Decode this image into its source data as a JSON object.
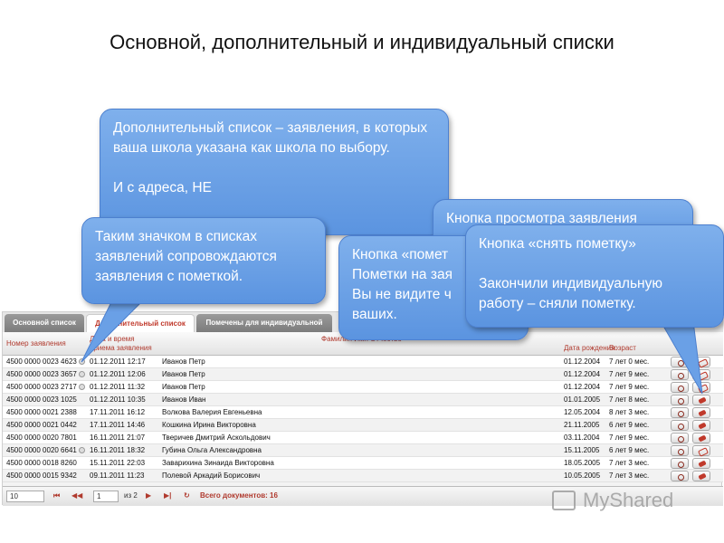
{
  "title": "Основной, дополнительный и индивидуальный списки",
  "tabs": [
    {
      "label": "Основной список",
      "active": false
    },
    {
      "label": "Дополнительный список",
      "active": true
    },
    {
      "label": "Помечены для индивидуальной работы",
      "active": false
    }
  ],
  "headers": {
    "number": "Номер заявления",
    "datetime_line1": "Дата и время",
    "datetime_line2": "приема заявления",
    "fio": "Фамилия Имя Отчество",
    "birth": "Дата рождения",
    "age": "Возраст"
  },
  "rows": [
    {
      "number": "4500 0000 0023 4623",
      "marked": true,
      "datetime": "01.12.2011 12:17",
      "name": "Иванов Петр",
      "birth": "01.12.2004",
      "age": "7 лет 0 мес."
    },
    {
      "number": "4500 0000 0023 3657",
      "marked": true,
      "datetime": "01.12.2011 12:06",
      "name": "Иванов Петр",
      "birth": "01.12.2004",
      "age": "7 лет 9 мес."
    },
    {
      "number": "4500 0000 0023 2717",
      "marked": true,
      "datetime": "01.12.2011 11:32",
      "name": "Иванов Петр",
      "birth": "01.12.2004",
      "age": "7 лет 9 мес."
    },
    {
      "number": "4500 0000 0023 1025",
      "marked": false,
      "datetime": "01.12.2011 10:35",
      "name": "Иванов Иван",
      "birth": "01.01.2005",
      "age": "7 лет 8 мес."
    },
    {
      "number": "4500 0000 0021 2388",
      "marked": false,
      "datetime": "17.11.2011 16:12",
      "name": "Волкова Валерия Евгеньевна",
      "birth": "12.05.2004",
      "age": "8 лет 3 мес."
    },
    {
      "number": "4500 0000 0021 0442",
      "marked": false,
      "datetime": "17.11.2011 14:46",
      "name": "Кошкина Ирина Викторовна",
      "birth": "21.11.2005",
      "age": "6 лет 9 мес."
    },
    {
      "number": "4500 0000 0020 7801",
      "marked": false,
      "datetime": "16.11.2011 21:07",
      "name": "Тверичев Дмитрий Аскольдович",
      "birth": "03.11.2004",
      "age": "7 лет 9 мес."
    },
    {
      "number": "4500 0000 0020 6641",
      "marked": true,
      "datetime": "16.11.2011 18:32",
      "name": "Губина Ольга Александровна",
      "birth": "15.11.2005",
      "age": "6 лет 9 мес."
    },
    {
      "number": "4500 0000 0018 8260",
      "marked": false,
      "datetime": "15.11.2011 22:03",
      "name": "Заварихина Зинаида Викторовна",
      "birth": "18.05.2005",
      "age": "7 лет 3 мес."
    },
    {
      "number": "4500 0000 0015 9342",
      "marked": false,
      "datetime": "09.11.2011 11:23",
      "name": "Полевой Аркадий Борисович",
      "birth": "10.05.2005",
      "age": "7 лет 3 мес."
    }
  ],
  "pager": {
    "page_size": "10",
    "page": "1",
    "of_pages": "из 2",
    "first": "⏮",
    "prev": "◀◀",
    "next": "▶",
    "last": "▶|",
    "refresh": "↻",
    "total": "Всего документов: 16"
  },
  "callouts": {
    "extra_list": "Дополнительный список – заявления, в которых ваша школа указана как школа по выбору.\n\nИ                           с адреса, НЕ",
    "icon_mark": "Таким значком в списках заявлений сопровождаются заявления с пометкой.",
    "view_button": "Кнопка просмотра заявления",
    "mark_button": "Кнопка «помет\nПометки на зая\nВы не видите ч\nваших.",
    "unmark_button": "Кнопка «снять пометку»\n\nЗакончили индивидуальную работу – сняли пометку."
  },
  "watermark": "MyShared"
}
